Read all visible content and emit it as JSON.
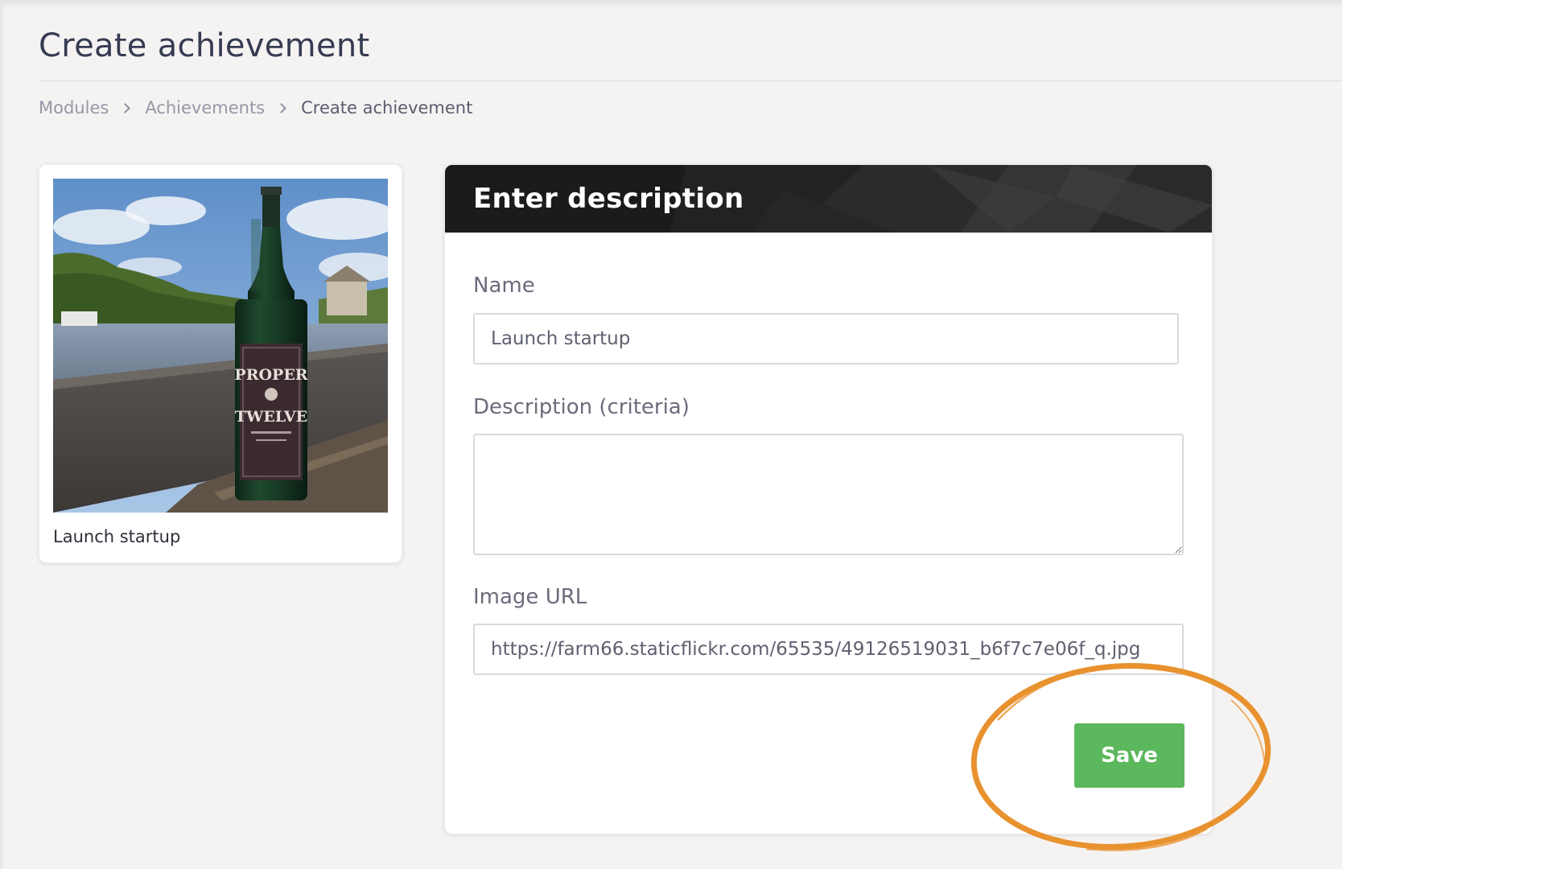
{
  "page": {
    "title": "Create achievement"
  },
  "breadcrumb": {
    "items": [
      "Modules",
      "Achievements",
      "Create achievement"
    ]
  },
  "preview": {
    "image_description": "photo of a green whiskey bottle on a stone wall by a river",
    "image_label_text": "PROPER TWELVE",
    "label": "Launch startup"
  },
  "form": {
    "header_title": "Enter description",
    "name_label": "Name",
    "name_value": "Launch startup",
    "description_label": "Description (criteria)",
    "description_value": "",
    "image_url_label": "Image URL",
    "image_url_value": "https://farm66.staticflickr.com/65535/49126519031_b6f7c7e06f_q.jpg",
    "save_label": "Save"
  },
  "colors": {
    "save_button": "#5cb85c",
    "highlight_circle": "#e8922f",
    "header_background": "#1b1b1b"
  }
}
